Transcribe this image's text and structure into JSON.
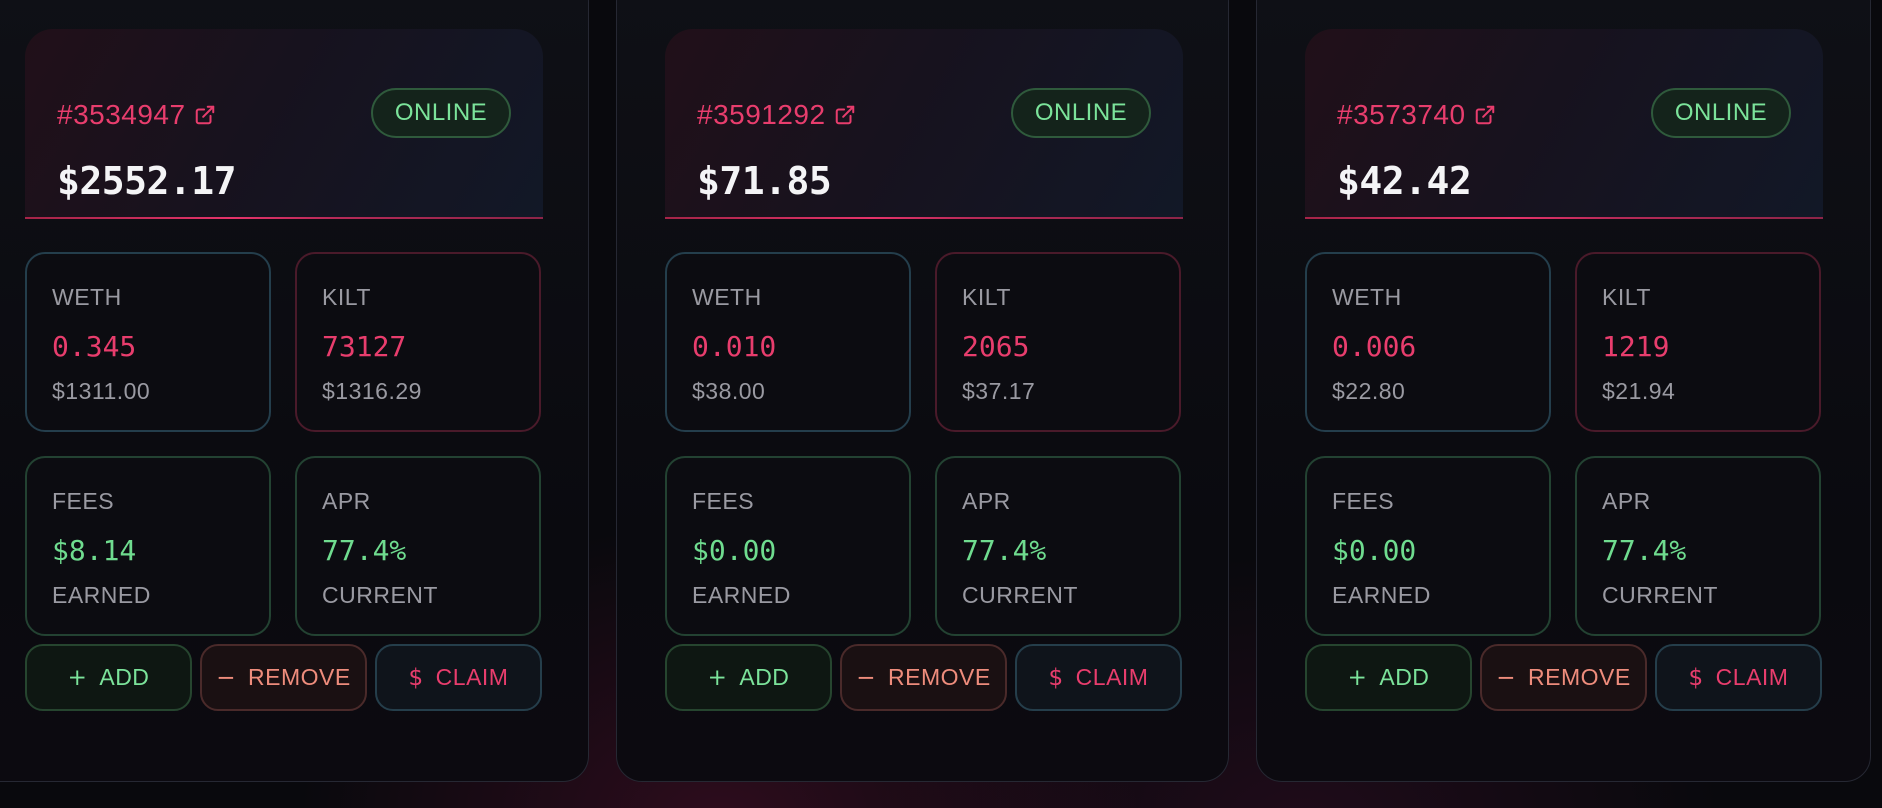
{
  "colors": {
    "accent_pink": "#e83d6d",
    "online_green": "#7be39a",
    "remove_salmon": "#ee8c7c",
    "muted_text": "#9a9aa2"
  },
  "positions": [
    {
      "id": "#3534947",
      "status": "ONLINE",
      "value": "$2552.17",
      "weth": {
        "label": "WETH",
        "amount": "0.345",
        "usd": "$1311.00"
      },
      "kilt": {
        "label": "KILT",
        "amount": "73127",
        "usd": "$1316.29"
      },
      "fees": {
        "label": "FEES",
        "amount": "$8.14",
        "sub": "EARNED"
      },
      "apr": {
        "label": "APR",
        "amount": "77.4%",
        "sub": "CURRENT"
      },
      "buttons": {
        "add": "ADD",
        "remove": "REMOVE",
        "claim": "CLAIM"
      }
    },
    {
      "id": "#3591292",
      "status": "ONLINE",
      "value": "$71.85",
      "weth": {
        "label": "WETH",
        "amount": "0.010",
        "usd": "$38.00"
      },
      "kilt": {
        "label": "KILT",
        "amount": "2065",
        "usd": "$37.17"
      },
      "fees": {
        "label": "FEES",
        "amount": "$0.00",
        "sub": "EARNED"
      },
      "apr": {
        "label": "APR",
        "amount": "77.4%",
        "sub": "CURRENT"
      },
      "buttons": {
        "add": "ADD",
        "remove": "REMOVE",
        "claim": "CLAIM"
      }
    },
    {
      "id": "#3573740",
      "status": "ONLINE",
      "value": "$42.42",
      "weth": {
        "label": "WETH",
        "amount": "0.006",
        "usd": "$22.80"
      },
      "kilt": {
        "label": "KILT",
        "amount": "1219",
        "usd": "$21.94"
      },
      "fees": {
        "label": "FEES",
        "amount": "$0.00",
        "sub": "EARNED"
      },
      "apr": {
        "label": "APR",
        "amount": "77.4%",
        "sub": "CURRENT"
      },
      "buttons": {
        "add": "ADD",
        "remove": "REMOVE",
        "claim": "CLAIM"
      }
    }
  ],
  "icons": {
    "external_link": "external-link-icon",
    "add": "plus-icon",
    "remove": "minus-icon",
    "claim": "dollar-icon"
  }
}
